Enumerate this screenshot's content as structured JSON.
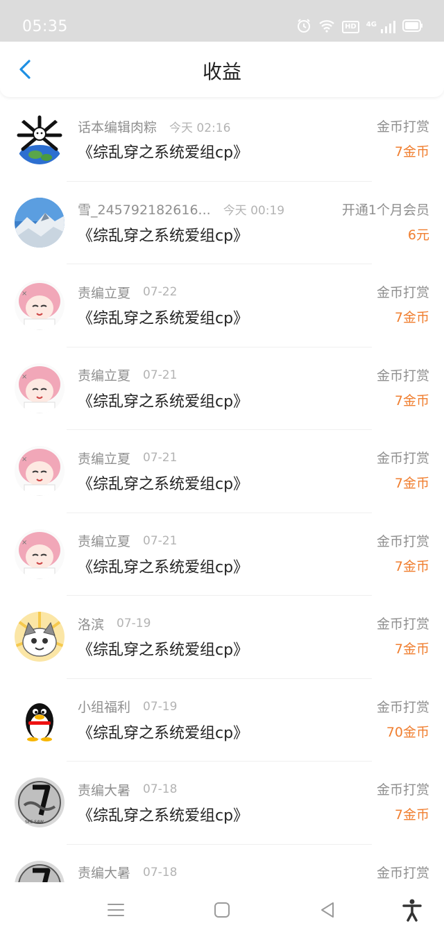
{
  "status": {
    "time": "05:35",
    "hd": "HD",
    "net": "4G"
  },
  "header": {
    "title": "收益"
  },
  "rows": [
    {
      "name": "话本编辑肉粽",
      "time": "今天 02:16",
      "book": "《综乱穿之系统爱组cp》",
      "type": "金币打赏",
      "amount": "7金币"
    },
    {
      "name": "雪_245792182616...",
      "time": "今天 00:19",
      "book": "《综乱穿之系统爱组cp》",
      "type": "开通1个月会员",
      "amount": "6元"
    },
    {
      "name": "责编立夏",
      "time": "07-22",
      "book": "《综乱穿之系统爱组cp》",
      "type": "金币打赏",
      "amount": "7金币"
    },
    {
      "name": "责编立夏",
      "time": "07-21",
      "book": "《综乱穿之系统爱组cp》",
      "type": "金币打赏",
      "amount": "7金币"
    },
    {
      "name": "责编立夏",
      "time": "07-21",
      "book": "《综乱穿之系统爱组cp》",
      "type": "金币打赏",
      "amount": "7金币"
    },
    {
      "name": "责编立夏",
      "time": "07-21",
      "book": "《综乱穿之系统爱组cp》",
      "type": "金币打赏",
      "amount": "7金币"
    },
    {
      "name": "洛滨",
      "time": "07-19",
      "book": "《综乱穿之系统爱组cp》",
      "type": "金币打赏",
      "amount": "7金币"
    },
    {
      "name": "小组福利",
      "time": "07-19",
      "book": "《综乱穿之系统爱组cp》",
      "type": "金币打赏",
      "amount": "70金币"
    },
    {
      "name": "责编大暑",
      "time": "07-18",
      "book": "《综乱穿之系统爱组cp》",
      "type": "金币打赏",
      "amount": "7金币"
    },
    {
      "name": "责编大暑",
      "time": "07-18",
      "book": "",
      "type": "金币打赏",
      "amount": ""
    }
  ],
  "colors": {
    "accent_blue": "#1e8fe3",
    "amount_orange": "#f07e2f",
    "status_bar_bg": "#dcdcdc"
  },
  "icons": [
    "back-arrow-icon",
    "alarm-icon",
    "wifi-icon",
    "signal-icon",
    "battery-icon",
    "menu-icon",
    "home-icon",
    "back-icon",
    "accessibility-icon"
  ]
}
